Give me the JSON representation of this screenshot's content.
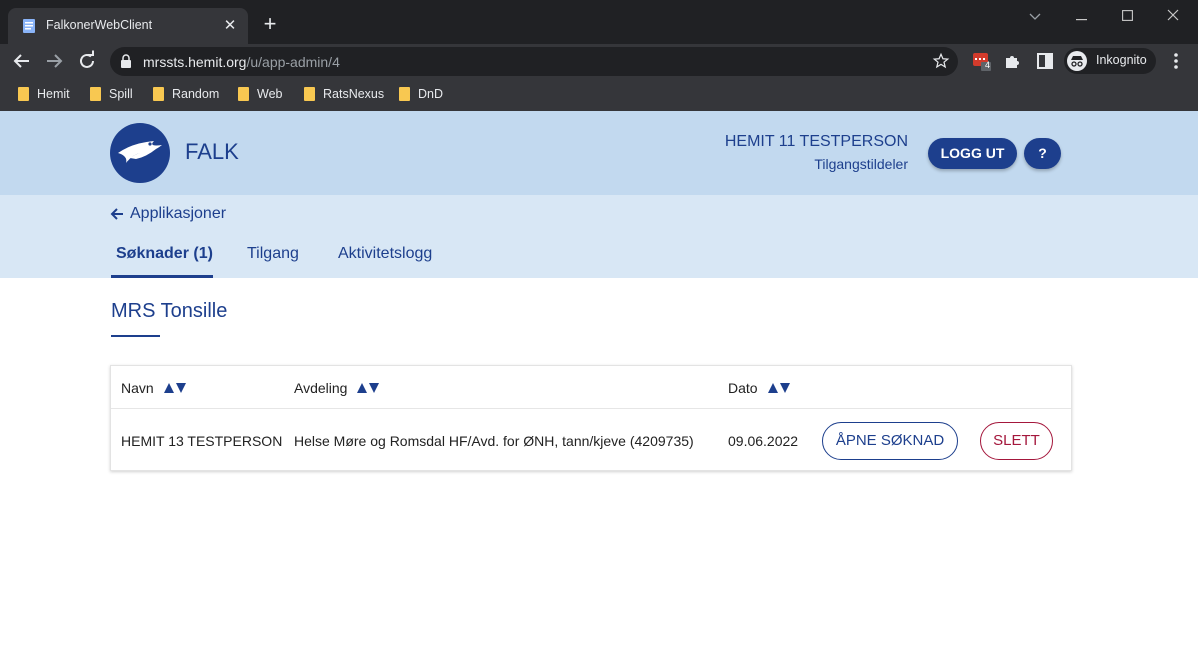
{
  "browser": {
    "tab_title": "FalkonerWebClient",
    "url_host": "mrssts.hemit.org",
    "url_path": "/u/app-admin/4",
    "extension_badge": "4",
    "profile_label": "Inkognito",
    "bookmarks": [
      "Hemit",
      "Spill",
      "Random",
      "Web",
      "RatsNexus",
      "DnD"
    ]
  },
  "header": {
    "brand": "FALK",
    "user_name": "HEMIT 11 TESTPERSON",
    "user_role": "Tilgangstildeler",
    "logout_label": "LOGG UT",
    "help_label": "?"
  },
  "subnav": {
    "back_label": "Applikasjoner",
    "tabs": [
      {
        "label": "Søknader (1)",
        "active": true
      },
      {
        "label": "Tilgang",
        "active": false
      },
      {
        "label": "Aktivitetslogg",
        "active": false
      }
    ]
  },
  "main": {
    "title": "MRS Tonsille",
    "columns": [
      "Navn",
      "Avdeling",
      "Dato"
    ],
    "rows": [
      {
        "navn": "HEMIT 13 TESTPERSON",
        "avdeling": "Helse Møre og Romsdal HF/Avd. for ØNH, tann/kjeve (4209735)",
        "dato": "09.06.2022",
        "open_label": "ÅPNE SØKNAD",
        "delete_label": "SLETT"
      }
    ]
  },
  "colors": {
    "primary": "#1d3f8d",
    "danger": "#a4173c",
    "header_bg": "#c2d9ef",
    "subnav_bg": "#d8e7f5"
  }
}
